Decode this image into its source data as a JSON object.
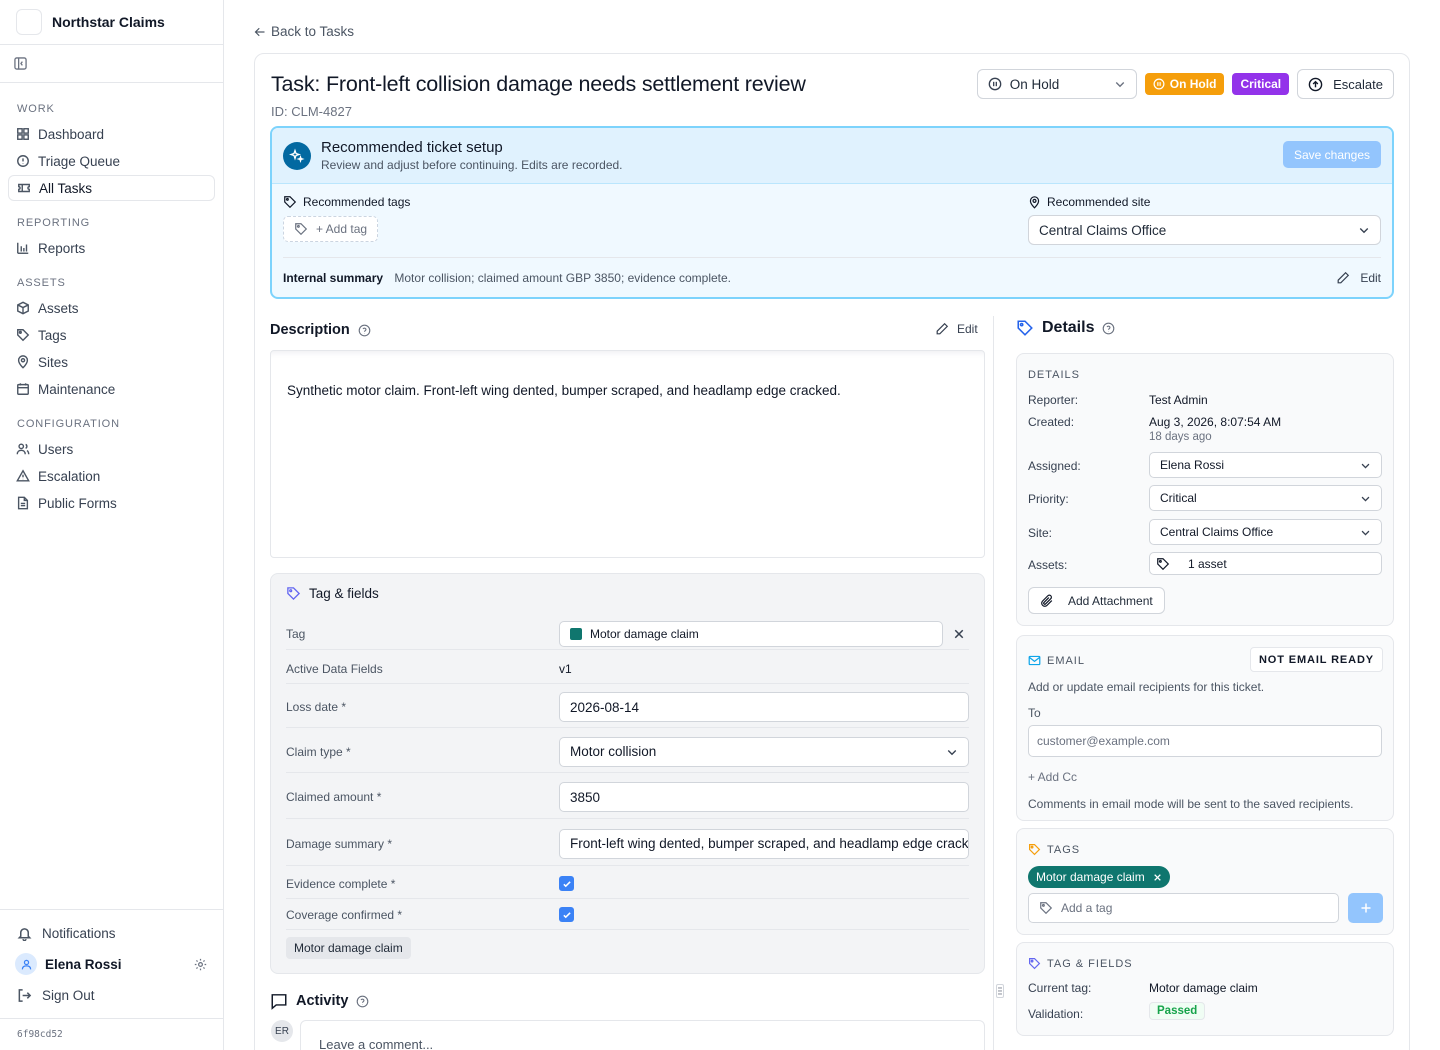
{
  "app": {
    "name": "Northstar Claims",
    "build": "6f98cd52"
  },
  "sidebar": {
    "sections": [
      {
        "label": "WORK",
        "items": [
          {
            "label": "Dashboard",
            "icon": "grid-icon"
          },
          {
            "label": "Triage Queue",
            "icon": "alert-circle-icon"
          },
          {
            "label": "All Tasks",
            "icon": "ticket-icon",
            "active": true
          }
        ]
      },
      {
        "label": "REPORTING",
        "items": [
          {
            "label": "Reports",
            "icon": "bar-chart-icon"
          }
        ]
      },
      {
        "label": "ASSETS",
        "items": [
          {
            "label": "Assets",
            "icon": "box-icon"
          },
          {
            "label": "Tags",
            "icon": "tag-icon"
          },
          {
            "label": "Sites",
            "icon": "map-pin-icon"
          },
          {
            "label": "Maintenance",
            "icon": "calendar-icon"
          }
        ]
      },
      {
        "label": "CONFIGURATION",
        "items": [
          {
            "label": "Users",
            "icon": "users-icon"
          },
          {
            "label": "Escalation",
            "icon": "triangle-alert-icon"
          },
          {
            "label": "Public Forms",
            "icon": "file-icon"
          }
        ]
      }
    ],
    "notifications": "Notifications",
    "user_name": "Elena Rossi",
    "sign_out": "Sign Out"
  },
  "header": {
    "back": "Back to Tasks",
    "title": "Task: Front-left collision damage needs settlement review",
    "id": "ID: CLM-4827",
    "status_value": "On Hold",
    "status_badge": "On Hold",
    "priority_badge": "Critical",
    "escalate": "Escalate"
  },
  "recommendation": {
    "title": "Recommended ticket setup",
    "subtitle": "Review and adjust before continuing. Edits are recorded.",
    "save": "Save changes",
    "tags_label": "Recommended tags",
    "add_tag": "+ Add tag",
    "site_label": "Recommended site",
    "site_value": "Central Claims Office",
    "summary_label": "Internal summary",
    "summary_value": "Motor collision; claimed amount GBP 3850; evidence complete.",
    "edit": "Edit"
  },
  "description": {
    "title": "Description",
    "edit": "Edit",
    "text": "Synthetic motor claim. Front-left wing dented, bumper scraped, and headlamp edge cracked."
  },
  "tag_fields": {
    "title": "Tag & fields",
    "tag_label": "Tag",
    "tag_value": "Motor damage claim",
    "tag_color": "#0f766e",
    "active_label": "Active Data Fields",
    "active_value": "v1",
    "loss_date_label": "Loss date *",
    "loss_date_value": "2026-08-14",
    "claim_type_label": "Claim type *",
    "claim_type_value": "Motor collision",
    "amount_label": "Claimed amount *",
    "amount_value": "3850",
    "damage_label": "Damage summary *",
    "damage_value": "Front-left wing dented, bumper scraped, and headlamp edge cracked.",
    "evidence_label": "Evidence complete *",
    "evidence_checked": true,
    "coverage_label": "Coverage confirmed *",
    "coverage_checked": true,
    "chip": "Motor damage claim"
  },
  "activity": {
    "title": "Activity",
    "avatar": "ER",
    "placeholder": "Leave a comment..."
  },
  "details": {
    "title": "Details",
    "section": "DETAILS",
    "reporter_label": "Reporter:",
    "reporter_value": "Test Admin",
    "created_label": "Created:",
    "created_value": "Aug 3, 2026, 8:07:54 AM",
    "created_ago": "18 days ago",
    "assigned_label": "Assigned:",
    "assigned_value": "Elena Rossi",
    "priority_label": "Priority:",
    "priority_value": "Critical",
    "site_label": "Site:",
    "site_value": "Central Claims Office",
    "assets_label": "Assets:",
    "assets_value": "1 asset",
    "attachment": "Add Attachment"
  },
  "email": {
    "section": "EMAIL",
    "status": "NOT EMAIL READY",
    "hint": "Add or update email recipients for this ticket.",
    "to_label": "To",
    "to_placeholder": "customer@example.com",
    "add_cc": "+ Add Cc",
    "note": "Comments in email mode will be sent to the saved recipients."
  },
  "tags_panel": {
    "section": "TAGS",
    "tag": "Motor damage claim",
    "placeholder": "Add a tag"
  },
  "tag_fields_panel": {
    "section": "TAG & FIELDS",
    "current_label": "Current tag:",
    "current_value": "Motor damage claim",
    "validation_label": "Validation:",
    "validation_value": "Passed"
  }
}
